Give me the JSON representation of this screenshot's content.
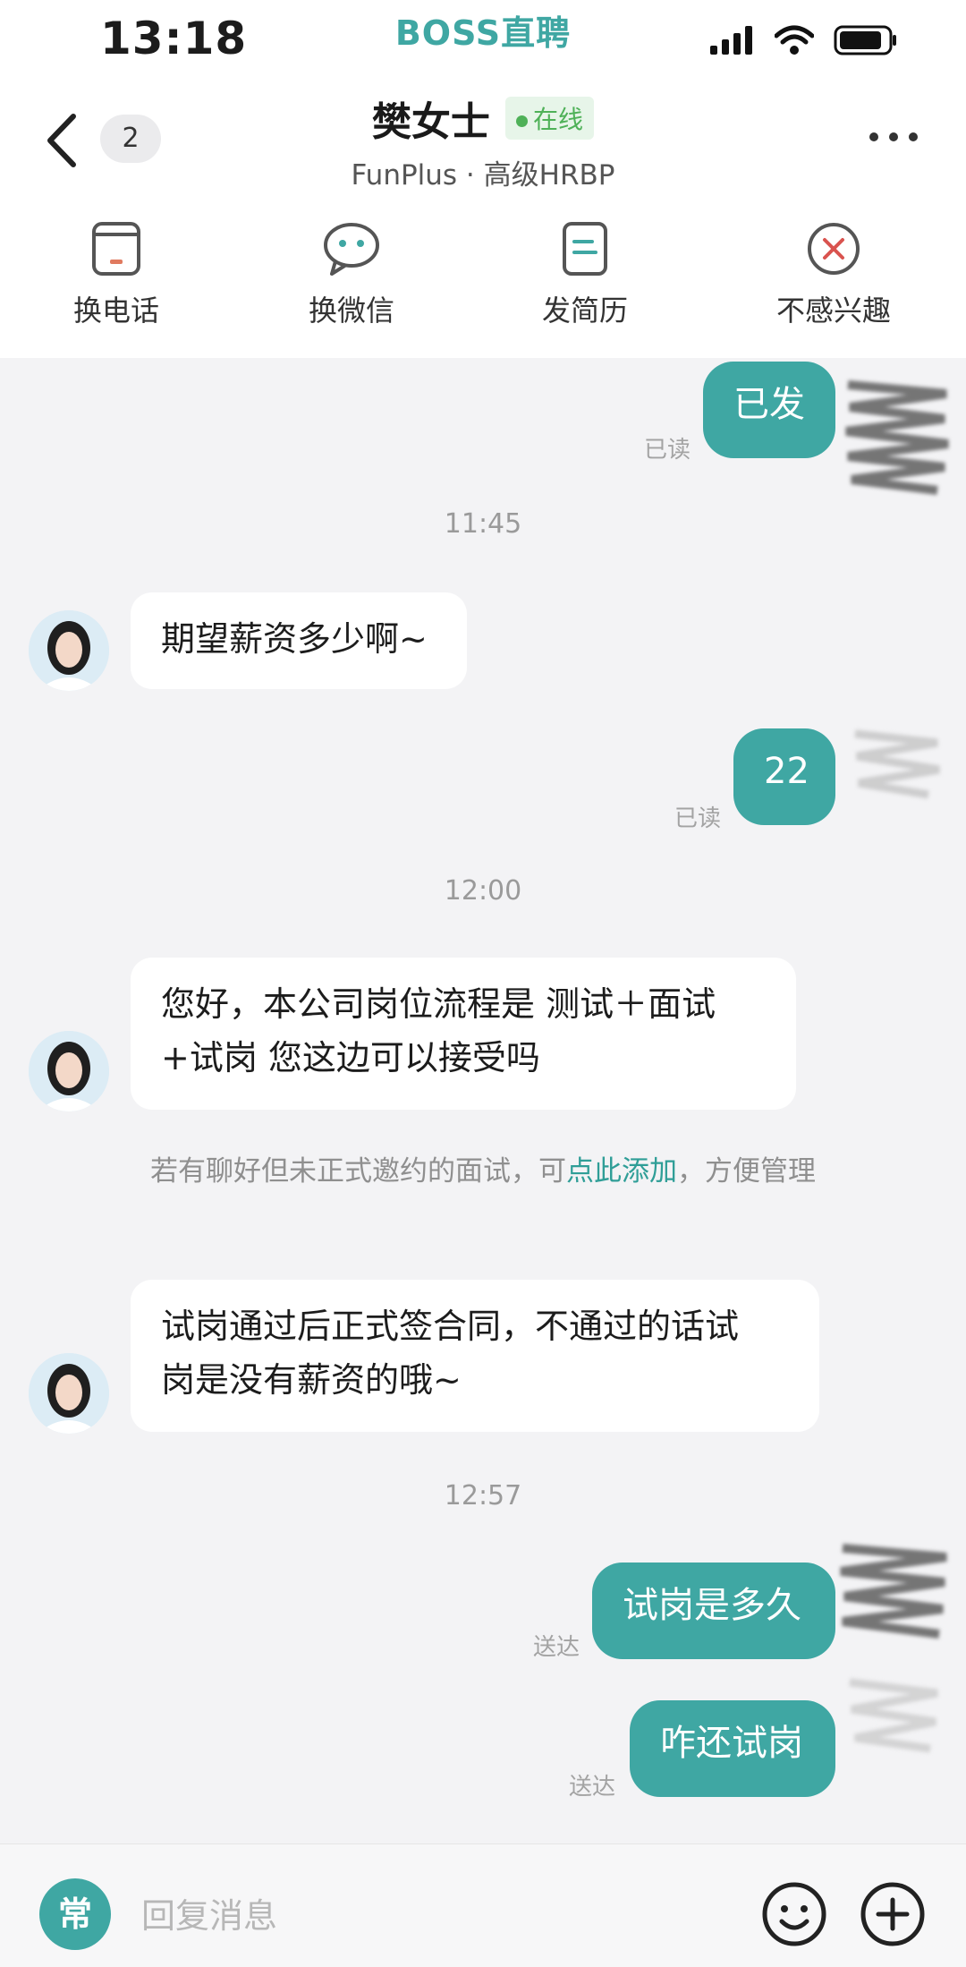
{
  "status_bar": {
    "time": "13:18",
    "app_brand": "BOSS直聘"
  },
  "header": {
    "unread_count": "2",
    "contact_name": "樊女士",
    "online_label": "在线",
    "contact_subtitle": "FunPlus · 高级HRBP"
  },
  "actions": [
    {
      "label": "换电话",
      "icon": "phone-card-icon"
    },
    {
      "label": "换微信",
      "icon": "wechat-icon"
    },
    {
      "label": "发简历",
      "icon": "resume-icon"
    },
    {
      "label": "不感兴趣",
      "icon": "not-interested-icon"
    }
  ],
  "messages": {
    "m1": {
      "text": "已发",
      "status": "已读"
    },
    "t1": "11:45",
    "m2": {
      "text": "期望薪资多少啊~"
    },
    "m3": {
      "text": "22",
      "status": "已读"
    },
    "t2": "12:00",
    "m4": {
      "line1": "您好，本公司岗位流程是 测试＋面试",
      "line2": "+试岗 您这边可以接受吗"
    },
    "system_note": {
      "before": "若有聊好但未正式邀约的面试，可",
      "link": "点此添加",
      "after": "，方便管理"
    },
    "m5": {
      "line1": "试岗通过后正式签合同，不通过的话试",
      "line2": "岗是没有薪资的哦~"
    },
    "t3": "12:57",
    "m6": {
      "text": "试岗是多久",
      "status": "送达"
    },
    "m7": {
      "text": "咋还试岗",
      "status": "送达"
    }
  },
  "composer": {
    "quick_label": "常",
    "placeholder": "回复消息",
    "emoji_icon": "emoji-icon",
    "plus_icon": "plus-icon"
  },
  "colors": {
    "accent": "#3fa7a3",
    "online": "#4fb158",
    "background": "#f3f3f5"
  }
}
